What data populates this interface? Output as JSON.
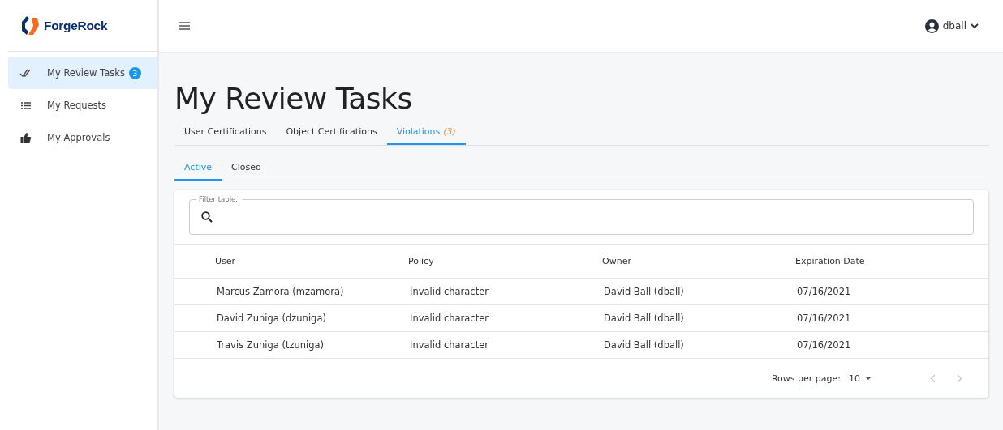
{
  "sidebar": {
    "logo": "ForgeRock",
    "items": [
      {
        "label": "My Review Tasks",
        "badge": "3",
        "selected": true
      },
      {
        "label": "My Requests",
        "selected": false
      },
      {
        "label": "My Approvals",
        "selected": false
      }
    ]
  },
  "header": {
    "user": "dball"
  },
  "page_title": "My Review Tasks",
  "tabs": [
    {
      "label": "User Certifications",
      "selected": false
    },
    {
      "label": "Object Certifications",
      "selected": false
    },
    {
      "label": "Violations",
      "count": "(3)",
      "selected": true
    }
  ],
  "subtabs": [
    {
      "label": "Active",
      "selected": true
    },
    {
      "label": "Closed",
      "selected": false
    }
  ],
  "filter": {
    "label": "Filter table.."
  },
  "table": {
    "columns": [
      "User",
      "Policy",
      "Owner",
      "Expiration Date"
    ],
    "rows": [
      [
        "Marcus Zamora (mzamora)",
        "Invalid character",
        "David Ball (dball)",
        "07/16/2021"
      ],
      [
        "David Zuniga (dzuniga)",
        "Invalid character",
        "David Ball (dball)",
        "07/16/2021"
      ],
      [
        "Travis Zuniga (tzuniga)",
        "Invalid character",
        "David Ball (dball)",
        "07/16/2021"
      ]
    ]
  },
  "pagination": {
    "label": "Rows per page:",
    "value": "10",
    "prev_disabled": true,
    "next_disabled": true
  }
}
